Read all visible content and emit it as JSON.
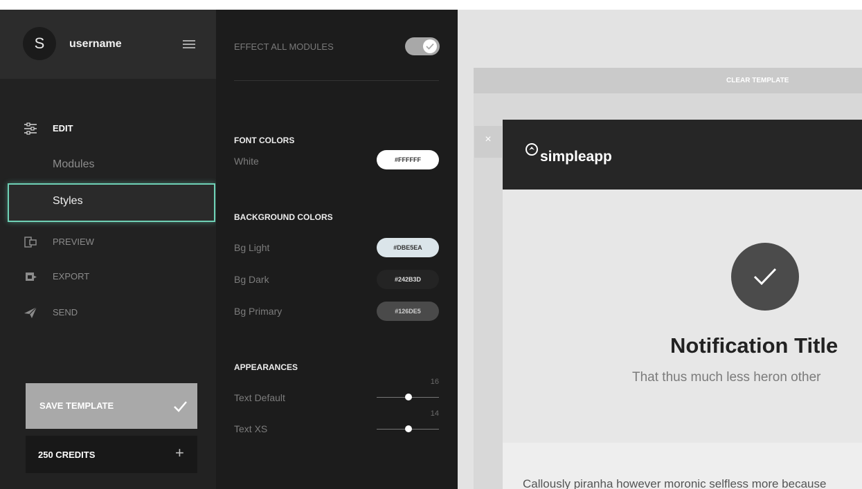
{
  "sidebar": {
    "avatar_initial": "S",
    "username": "username",
    "nav": {
      "edit": "EDIT",
      "modules": "Modules",
      "styles": "Styles",
      "preview": "PREVIEW",
      "export": "EXPORT",
      "send": "SEND"
    },
    "save_label": "SAVE TEMPLATE",
    "credits_label": "250 CREDITS",
    "credits_plus": "+"
  },
  "styles_panel": {
    "effect_all_label": "EFFECT ALL MODULES",
    "effect_all_on": true,
    "font_colors": {
      "heading": "FONT COLORS",
      "items": [
        {
          "label": "White",
          "value": "#FFFFFF"
        }
      ]
    },
    "background_colors": {
      "heading": "BACKGROUND COLORS",
      "items": [
        {
          "label": "Bg Light",
          "value": "#DBE5EA"
        },
        {
          "label": "Bg Dark",
          "value": "#242B3D"
        },
        {
          "label": "Bg Primary",
          "value": "#126DE5"
        }
      ]
    },
    "appearances": {
      "heading": "APPEARANCES",
      "items": [
        {
          "label": "Text Default",
          "value": "16"
        },
        {
          "label": "Text XS",
          "value": "14"
        }
      ]
    }
  },
  "preview": {
    "clear_label": "CLEAR TEMPLATE",
    "close_glyph": "×",
    "logo_text": "simpleapp",
    "notification_title": "Notification Title",
    "notification_subtitle": "That thus much less heron other",
    "body_text": "Callously piranha however moronic selfless more because"
  },
  "colors": {
    "accent_outline": "#6fd1b6",
    "sidebar_bg": "#222222",
    "panel_bg": "#1c1c1c",
    "header_bg": "#262626"
  }
}
